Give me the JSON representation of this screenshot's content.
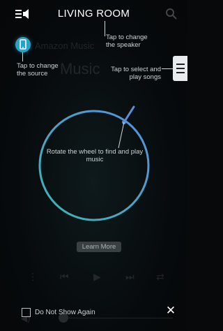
{
  "header": {
    "room_name": "LIVING ROOM"
  },
  "overlay": {
    "speaker_hint": "Tap to change\nthe speaker",
    "source_hint": "Tap to change\nthe source",
    "browse_hint": "Tap to select and\nplay songs",
    "wheel_hint": "Rotate the wheel to find and play music",
    "learn_more_label": "Learn More",
    "dont_show_label": "Do Not Show Again",
    "close_label": "✕"
  },
  "background": {
    "subtitle": "Amazon Music",
    "music_label": "Music"
  },
  "colors": {
    "accent": "#2aa2c6",
    "wheel_start": "#3bb7b3",
    "wheel_end": "#5a8fdc"
  }
}
